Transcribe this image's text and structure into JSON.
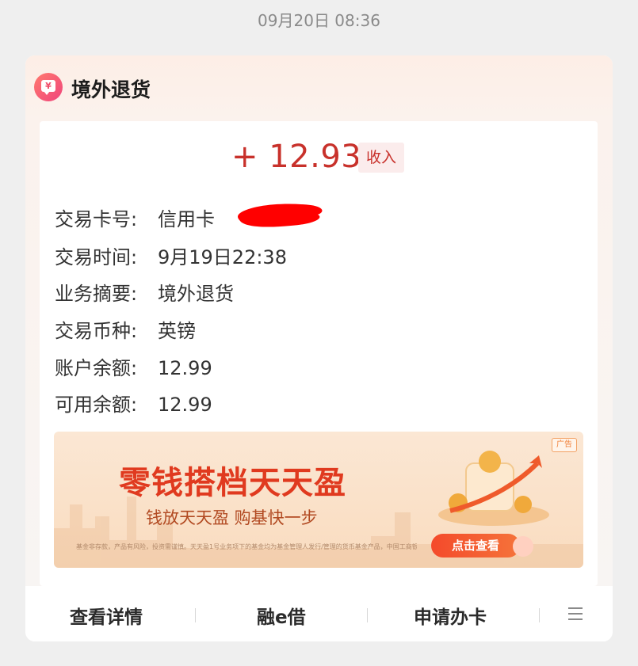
{
  "status": {
    "timestamp": "09月20日 08:36"
  },
  "card": {
    "title": "境外退货",
    "icon": "yuan-message-icon",
    "amount": "+ 12.93",
    "amount_tag": "收入",
    "details": [
      {
        "label": "交易卡号:",
        "value": "信用卡"
      },
      {
        "label": "交易时间:",
        "value": "9月19日22:38"
      },
      {
        "label": "业务摘要:",
        "value": "境外退货"
      },
      {
        "label": "交易币种:",
        "value": "英镑"
      },
      {
        "label": "账户余额:",
        "value": "12.99"
      },
      {
        "label": "可用余额:",
        "value": "12.99"
      }
    ]
  },
  "ad": {
    "badge": "广告",
    "title": "零钱搭档天天盈",
    "subtitle": "钱放天天盈 购基快一步",
    "disclaimer": "基金非存款，产品有风险，投资需谨慎。天天盈1号业务项下的基金均为基金管理人发行/管理的货币基金产品，中国工商银行作为代销机构不承担产品的投资和兑付责任。",
    "button": "点击查看"
  },
  "bottom_bar": {
    "items": [
      "查看详情",
      "融e借",
      "申请办卡"
    ],
    "menu_icon": "hamburger-menu-icon"
  },
  "colors": {
    "amount_red": "#c8312b",
    "ad_title_red": "#e03a1f",
    "ad_button": "#f44a2b"
  }
}
